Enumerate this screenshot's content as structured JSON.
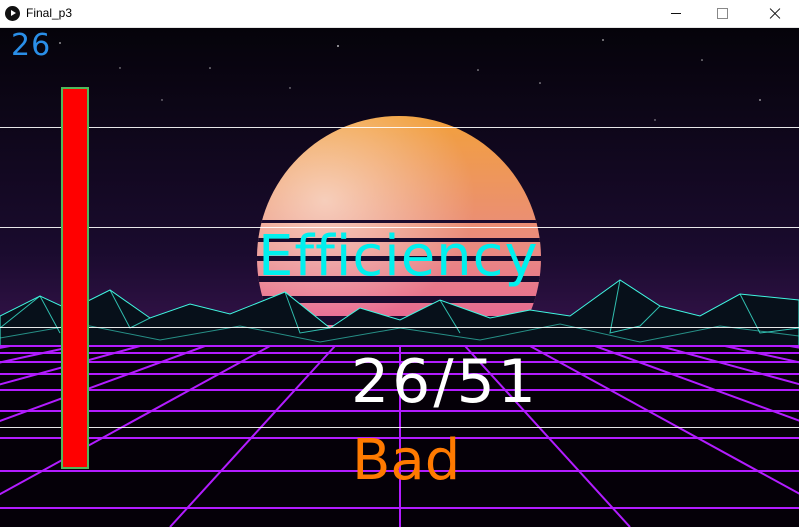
{
  "window": {
    "title": "Final_p3"
  },
  "hud": {
    "score": "26",
    "efficiency_label": "Efficiency",
    "ratio_text": "26/51",
    "rating": "Bad",
    "efficiency_fraction": 0.51
  },
  "colors": {
    "score": "#2a8fe8",
    "efficiency_label": "#00f0ee",
    "ratio_text": "#ffffff",
    "rating": "#ff7a00",
    "bar_fill": "#ff0000",
    "bar_border": "#4fb85a",
    "grid": "#b21cff",
    "mountains": "#3ff7e0",
    "sun_top": "#f2a13a",
    "sun_bottom": "#e8539c"
  },
  "icons": {
    "app": "processing-play-icon",
    "minimize": "minimize-icon",
    "maximize": "maximize-icon",
    "close": "close-icon"
  }
}
